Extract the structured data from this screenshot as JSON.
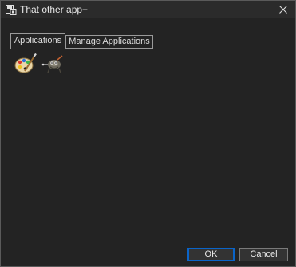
{
  "window": {
    "title": "That other app+",
    "icon": "app-window-icon",
    "close_icon": "close-icon"
  },
  "tabs": [
    {
      "label": "Applications",
      "selected": true
    },
    {
      "label": "Manage Applications",
      "selected": false
    }
  ],
  "applications": [
    {
      "icon": "paint-palette-icon"
    },
    {
      "icon": "gimp-icon"
    }
  ],
  "buttons": {
    "ok_label": "OK",
    "cancel_label": "Cancel"
  },
  "colors": {
    "window_background": "#232323",
    "titlebar": "#2b2b2b",
    "text": "#e6e6e6",
    "focus_accent": "#0a64c8"
  }
}
